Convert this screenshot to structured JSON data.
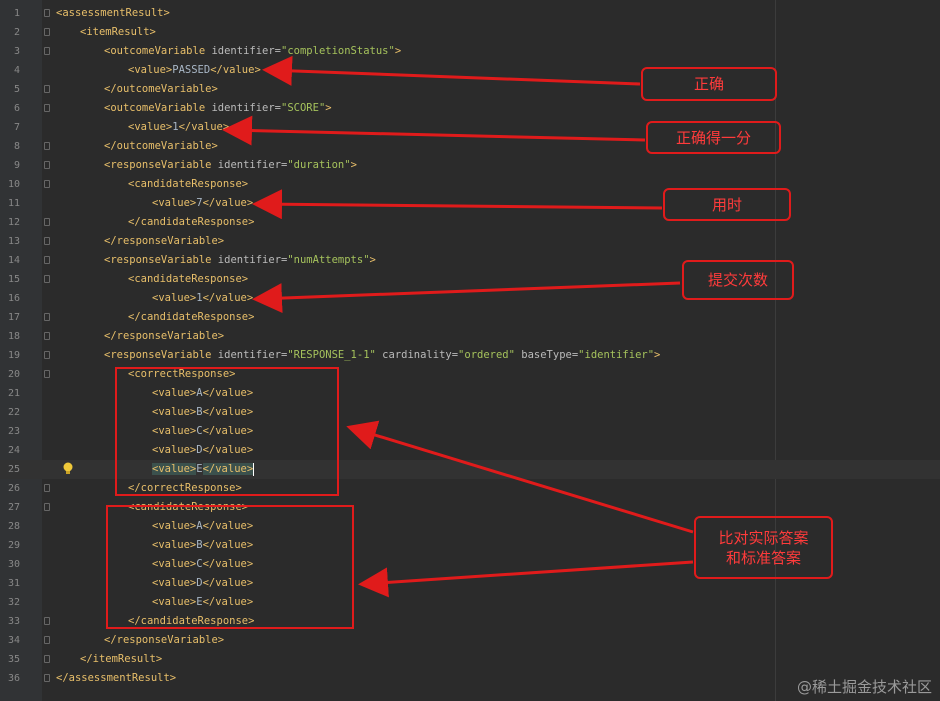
{
  "editor": {
    "lines": [
      {
        "n": "1",
        "tag": "<assessmentResult>"
      },
      {
        "n": "2",
        "tag": "<itemResult>"
      },
      {
        "n": "3",
        "tag": "<outcomeVariable ",
        "attr": "identifier=",
        "val": "\"completionStatus\"",
        "end": ">"
      },
      {
        "n": "4",
        "tag": "<value>",
        "text": "PASSED",
        "end": "</value>"
      },
      {
        "n": "5",
        "tag": "</outcomeVariable>"
      },
      {
        "n": "6",
        "tag": "<outcomeVariable ",
        "attr": "identifier=",
        "val": "\"SCORE\"",
        "end": ">"
      },
      {
        "n": "7",
        "tag": "<value>",
        "text": "1",
        "end": "</value>"
      },
      {
        "n": "8",
        "tag": "</outcomeVariable>"
      },
      {
        "n": "9",
        "tag": "<responseVariable ",
        "attr": "identifier=",
        "val": "\"duration\"",
        "end": ">"
      },
      {
        "n": "10",
        "tag": "<candidateResponse>"
      },
      {
        "n": "11",
        "tag": "<value>",
        "text": "7",
        "end": "</value>"
      },
      {
        "n": "12",
        "tag": "</candidateResponse>"
      },
      {
        "n": "13",
        "tag": "</responseVariable>"
      },
      {
        "n": "14",
        "tag": "<responseVariable ",
        "attr": "identifier=",
        "val": "\"numAttempts\"",
        "end": ">"
      },
      {
        "n": "15",
        "tag": "<candidateResponse>"
      },
      {
        "n": "16",
        "tag": "<value>",
        "text": "1",
        "end": "</value>"
      },
      {
        "n": "17",
        "tag": "</candidateResponse>"
      },
      {
        "n": "18",
        "tag": "</responseVariable>"
      },
      {
        "n": "19",
        "tag": "<responseVariable ",
        "attr": "identifier=",
        "val": "\"RESPONSE_1-1\"",
        "attr2": " cardinality=",
        "val2": "\"ordered\"",
        "attr3": " baseType=",
        "val3": "\"identifier\"",
        "end": ">"
      },
      {
        "n": "20",
        "tag": "<correctResponse>"
      },
      {
        "n": "21",
        "tag": "<value>",
        "text": "A",
        "end": "</value>"
      },
      {
        "n": "22",
        "tag": "<value>",
        "text": "B",
        "end": "</value>"
      },
      {
        "n": "23",
        "tag": "<value>",
        "text": "C",
        "end": "</value>"
      },
      {
        "n": "24",
        "tag": "<value>",
        "text": "D",
        "end": "</value>"
      },
      {
        "n": "25",
        "tag": "<value>",
        "text": "E",
        "end": "</value>"
      },
      {
        "n": "26",
        "tag": "</correctResponse>"
      },
      {
        "n": "27",
        "tag": "<candidateResponse>"
      },
      {
        "n": "28",
        "tag": "<value>",
        "text": "A",
        "end": "</value>"
      },
      {
        "n": "29",
        "tag": "<value>",
        "text": "B",
        "end": "</value>"
      },
      {
        "n": "30",
        "tag": "<value>",
        "text": "C",
        "end": "</value>"
      },
      {
        "n": "31",
        "tag": "<value>",
        "text": "D",
        "end": "</value>"
      },
      {
        "n": "32",
        "tag": "<value>",
        "text": "E",
        "end": "</value>"
      },
      {
        "n": "33",
        "tag": "</candidateResponse>"
      },
      {
        "n": "34",
        "tag": "</responseVariable>"
      },
      {
        "n": "35",
        "tag": "</itemResult>"
      },
      {
        "n": "36",
        "tag": "</assessmentResult>"
      }
    ],
    "colors": {
      "tag": "#e8bf6a",
      "attr": "#bababa",
      "value": "#a5c25c",
      "text": "#a9b7c6",
      "background": "#2b2b2b"
    },
    "lightbulb_icon": "lightbulb-icon"
  },
  "annotations": {
    "correct": "正确",
    "score": "正确得一分",
    "duration": "用时",
    "attempts": "提交次数",
    "compare_line1": "比对实际答案",
    "compare_line2": "和标准答案",
    "color": "#e01b1b"
  },
  "watermark": "@稀土掘金技术社区"
}
